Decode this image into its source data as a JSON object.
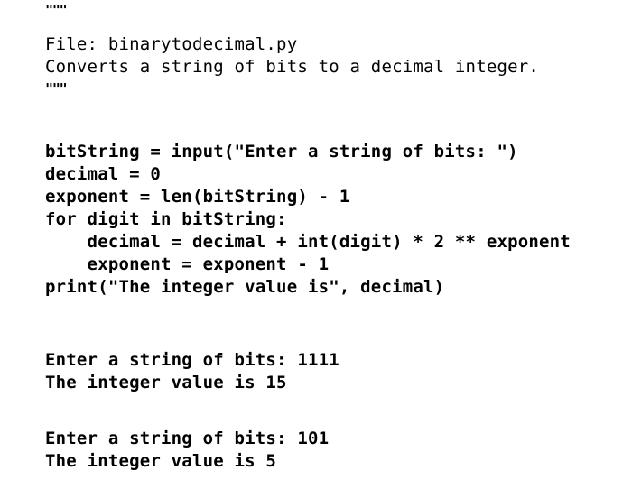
{
  "document": {
    "kind": "python-program-listing",
    "file_name": "binarytodecimal.py",
    "background_color": "#ffffff",
    "text_color": "#000000"
  },
  "docstring": {
    "open_delimiter": "\"\"\"",
    "close_delimiter": "\"\"\"",
    "lines": [
      "File: binarytodecimal.py",
      "Converts a string of bits to a decimal integer."
    ]
  },
  "source": {
    "lines": [
      "bitString = input(\"Enter a string of bits: \")",
      "decimal = 0",
      "exponent = len(bitString) - 1",
      "for digit in bitString:",
      "    decimal = decimal + int(digit) * 2 ** exponent",
      "    exponent = exponent - 1",
      "print(\"The integer value is\", decimal)"
    ]
  },
  "console": {
    "sessions": [
      {
        "prompt_line": "Enter a string of bits: 1111",
        "result_line": "The integer value is 15",
        "input_value": "1111",
        "output_value": "15"
      },
      {
        "prompt_line": "Enter a string of bits: 101",
        "result_line": "The integer value is 5",
        "input_value": "101",
        "output_value": "5"
      }
    ]
  }
}
